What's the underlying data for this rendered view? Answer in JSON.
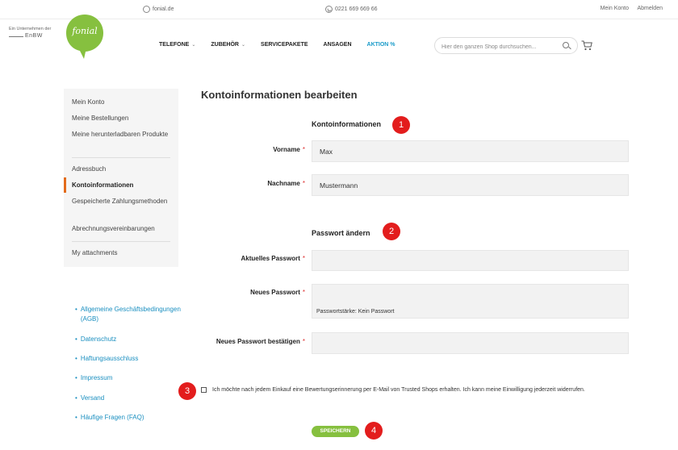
{
  "topbar": {
    "website": "fonial.de",
    "phone": "0221 669 669 66",
    "account": "Mein Konto",
    "logout": "Abmelden"
  },
  "header": {
    "enbw_tagline": "Ein Unternehmen der",
    "enbw_logo": "EnBW",
    "logo_text": "fonial",
    "brand_color": "#86c03f",
    "nav": [
      {
        "label": "TELEFONE",
        "dropdown": true
      },
      {
        "label": "ZUBEHÖR",
        "dropdown": true
      },
      {
        "label": "SERVICEPAKETE",
        "dropdown": false
      },
      {
        "label": "ANSAGEN",
        "dropdown": false
      },
      {
        "label": "AKTION %",
        "dropdown": false
      }
    ],
    "search_placeholder": "Hier den ganzen Shop durchsuchen..."
  },
  "sidebar": {
    "items": [
      {
        "label": "Mein Konto"
      },
      {
        "label": "Meine Bestellungen"
      },
      {
        "label": "Meine herunterladbaren Produkte"
      },
      {
        "label": "Adressbuch"
      },
      {
        "label": "Kontoinformationen",
        "active": true
      },
      {
        "label": "Gespeicherte Zahlungsmethoden"
      },
      {
        "label": "Abrechnungsvereinbarungen"
      },
      {
        "label": "My attachments"
      }
    ],
    "active_color": "#e36b1c"
  },
  "footer_links": [
    "Allgemeine Geschäftsbedingungen (AGB)",
    "Datenschutz",
    "Haftungsausschluss",
    "Impressum",
    "Versand",
    "Häufige Fragen (FAQ)"
  ],
  "main": {
    "title": "Kontoinformationen bearbeiten",
    "section_account": "Kontoinformationen",
    "first_name_label": "Vorname",
    "first_name_value": "Max",
    "last_name_label": "Nachname",
    "last_name_value": "Mustermann",
    "section_password": "Passwort ändern",
    "current_password_label": "Aktuelles Passwort",
    "current_password_value": "",
    "new_password_label": "Neues Passwort",
    "new_password_value": "",
    "password_strength": "Passwortstärke: Kein Passwort",
    "confirm_password_label": "Neues Passwort bestätigen",
    "confirm_password_value": "",
    "required_marker": "*",
    "trusted_shops_text": "Ich möchte nach jedem Einkauf eine Bewertungserinnerung per E-Mail von Trusted Shops erhalten. Ich kann meine Einwilligung jederzeit widerrufen.",
    "trusted_shops_checked": false,
    "save_label": "SPEICHERN"
  },
  "annotations": [
    "1",
    "2",
    "3",
    "4"
  ],
  "annotation_color": "#e31d1d"
}
